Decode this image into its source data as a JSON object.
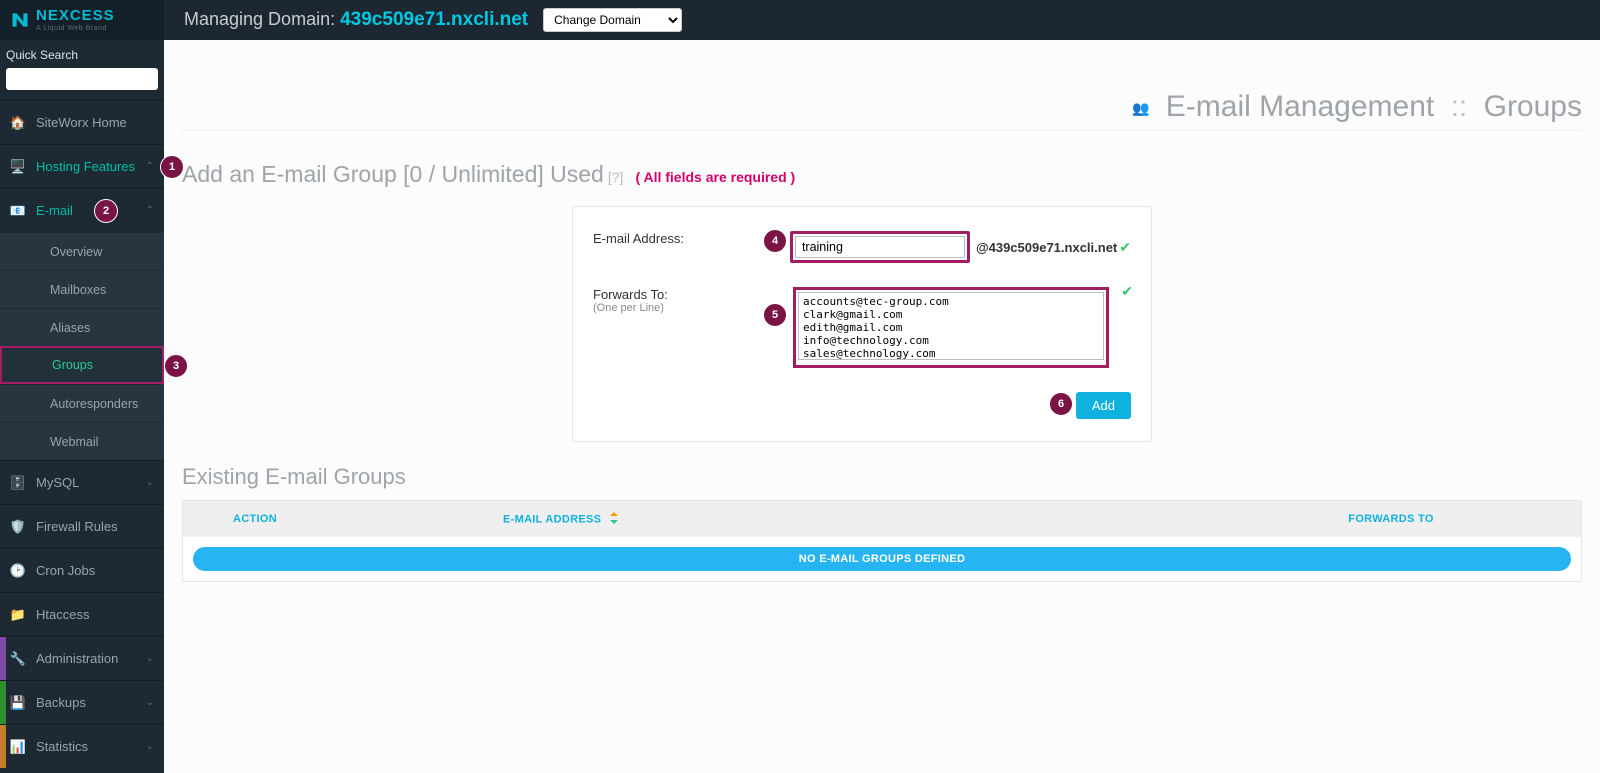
{
  "brand": {
    "name": "NEXCESS",
    "sub": "A Liquid Web Brand"
  },
  "topbar": {
    "managing_label": "Managing Domain:",
    "domain": "439c509e71.nxcli.net",
    "change_domain": "Change Domain"
  },
  "sidebar": {
    "quick_label": "Quick Search",
    "siteworx_home": "SiteWorx Home",
    "hosting_features": "Hosting Features",
    "email": "E-mail",
    "email_sub": {
      "overview": "Overview",
      "mailboxes": "Mailboxes",
      "aliases": "Aliases",
      "groups": "Groups",
      "autoresponders": "Autoresponders",
      "webmail": "Webmail"
    },
    "mysql": "MySQL",
    "firewall": "Firewall Rules",
    "cron": "Cron Jobs",
    "htaccess": "Htaccess",
    "administration": "Administration",
    "backups": "Backups",
    "statistics": "Statistics"
  },
  "page": {
    "title_main": "E-mail Management",
    "title_sub": "Groups"
  },
  "form": {
    "heading": "Add an E-mail Group [0 / Unlimited] Used",
    "hint": "[?]",
    "required": "( All fields are required )",
    "email_label": "E-mail Address:",
    "email_value": "training",
    "domain_suffix": "@439c509e71.nxcli.net",
    "forwards_label": "Forwards To:",
    "forwards_sub": "(One per Line)",
    "forwards_value": "accounts@tec-group.com\nclark@gmail.com\nedith@gmail.com\ninfo@technology.com\nsales@technology.com",
    "add_label": "Add"
  },
  "dots": {
    "1": "1",
    "2": "2",
    "3": "3",
    "4": "4",
    "5": "5",
    "6": "6"
  },
  "table": {
    "heading": "Existing E-mail Groups",
    "col_action": "ACTION",
    "col_email": "E-MAIL ADDRESS",
    "col_fwd": "FORWARDS TO",
    "empty": "NO E-MAIL GROUPS DEFINED"
  }
}
